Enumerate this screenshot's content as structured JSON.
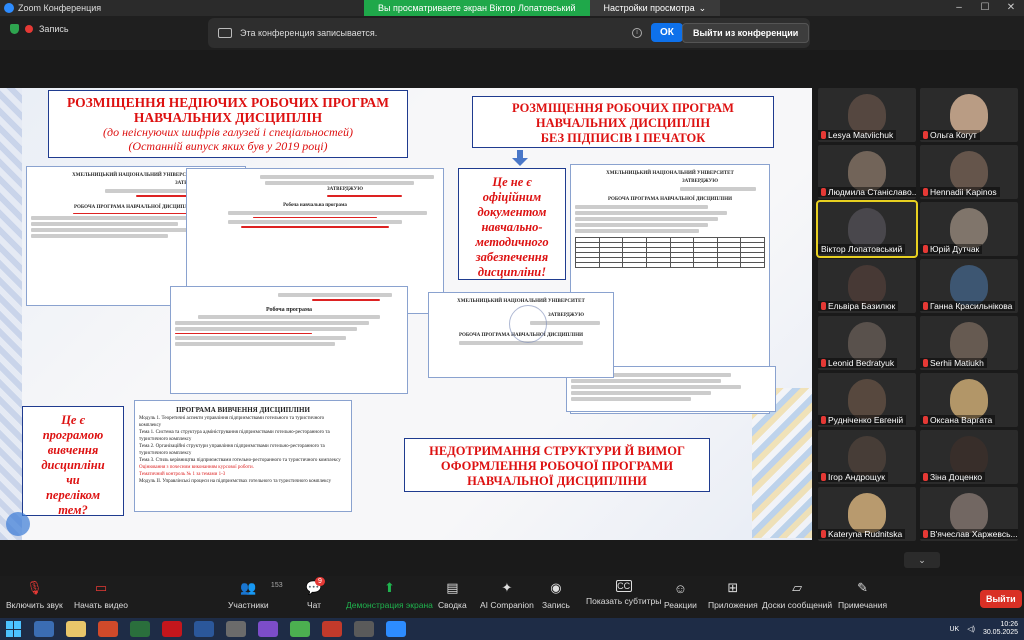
{
  "window": {
    "title": "Zoom Конференция"
  },
  "banner": {
    "viewing": "Вы просматриваете экран Віктор Лопатовський",
    "settings": "Настройки просмотра"
  },
  "recording": {
    "status": "Запись",
    "notice": "Эта конференция записывается.",
    "ok": "ОК",
    "leave": "Выйти из конференции"
  },
  "slide": {
    "box1_line1": "РОЗМІЩЕННЯ НЕДІЮЧИХ РОБОЧИХ ПРОГРАМ",
    "box1_line2": "НАВЧАЛЬНИХ ДИСЦИПЛІН",
    "box1_line3": "(до неіснуючих шифрів галузей і спеціальностей)",
    "box1_line4": "(Останній випуск яких був у 2019 році)",
    "box2_line1": "РОЗМІЩЕННЯ РОБОЧИХ ПРОГРАМ",
    "box2_line2": "НАВЧАЛЬНИХ ДИСЦИПЛІН",
    "box2_line3": "БЕЗ ПІДПИСІВ І ПЕЧАТОК",
    "box3": [
      "Це не є",
      "офіційним",
      "документом",
      "навчально-",
      "методичного",
      "забезпечення",
      "дисципліни!"
    ],
    "box4": [
      "Це є",
      "програмою",
      "вивчення",
      "дисципліни",
      "чи",
      "переліком",
      "тем?"
    ],
    "box5_line1": "НЕДОТРИМАННЯ СТРУКТУРИ Й ВИМОГ",
    "box5_line2": "ОФОРМЛЕННЯ РОБОЧОЇ ПРОГРАМИ",
    "box5_line3": "НАВЧАЛЬНОЇ ДИСЦИПЛІНИ",
    "doc_univ": "ХМЕЛЬНИЦЬКИЙ НАЦІОНАЛЬНИЙ УНІВЕРСИТЕТ",
    "doc_approve": "ЗАТВЕРДЖУЮ",
    "doc_rp": "РОБОЧА ПРОГРАМА НАВЧАЛЬНОЇ ДИСЦИПЛІНИ",
    "doc_rp2": "Робоча програма",
    "doc_plan": "Робоча навчальна програма",
    "doc_program": "ПРОГРАМА ВИВЧЕННЯ ДИСЦИПЛІНИ",
    "doc_program_items": [
      "Модуль 1. Теоретичні аспекти управління підприємствами готельного та туристичного комплексу",
      "Тема 1. Система та структура адміністрування підприємствами готельно-ресторанного та туристичного комплексу",
      "Тема 2. Організаційні структури управління підприємствами готельно-ресторанного та туристичного комплексу",
      "Тема 3. Стиль керівництва підприємствами готельно-ресторанного та туристичного комплексу",
      "Оцінювання з почесним виконанням курсової роботи.",
      "Тематичний контроль № 1 за темами 1-3",
      "Модуль II. Управлінські процеси на підприємствах готельного та туристичного комплексу"
    ]
  },
  "participants": [
    {
      "name": "Lesya Matviichuk",
      "muted": true,
      "color": "#5a4a42"
    },
    {
      "name": "Ольга Когут",
      "muted": true,
      "color": "#c9a98e"
    },
    {
      "name": "Людмила Станіславо...",
      "muted": true,
      "color": "#7a6a5e"
    },
    {
      "name": "Hennadii Kapinos",
      "muted": true,
      "color": "#6b5a4f"
    },
    {
      "name": "Віктор Лопатовський",
      "muted": false,
      "color": "#4d4a50"
    },
    {
      "name": "Юрій Дутчак",
      "muted": true,
      "color": "#8a7d72"
    },
    {
      "name": "Ельвіра Базилюк",
      "muted": true,
      "color": "#4a3b36"
    },
    {
      "name": "Ганна Красильнікова",
      "muted": true,
      "color": "#3f5b7a"
    },
    {
      "name": "Leonid Bedratyuk",
      "muted": true,
      "color": "#5e5550"
    },
    {
      "name": "Serhii Matiukh",
      "muted": true,
      "color": "#6d5f55"
    },
    {
      "name": "Рудніченко Евгеній",
      "muted": true,
      "color": "#5c4b40"
    },
    {
      "name": "Оксана Варгата",
      "muted": true,
      "color": "#c1a26f"
    },
    {
      "name": "Ігор Андрощук",
      "muted": true,
      "color": "#4a3f38"
    },
    {
      "name": "Зіна Доценко",
      "muted": true,
      "color": "#3a2f2a"
    },
    {
      "name": "Kateryna Rudnitska",
      "muted": true,
      "color": "#c8a676"
    },
    {
      "name": "В'ячеслав Харжевсь...",
      "muted": true,
      "color": "#7a6e68"
    }
  ],
  "toolbar": {
    "unmute": "Включить звук",
    "video": "Начать видео",
    "participants": "Участники",
    "participants_count": "153",
    "chat": "Чат",
    "chat_badge": "9",
    "share": "Демонстрация экрана",
    "summary": "Сводка",
    "ai": "AI Companion",
    "record": "Запись",
    "subtitles": "Показать субтитры",
    "reactions": "Реакции",
    "apps": "Приложения",
    "whiteboards": "Доски сообщений",
    "notes": "Примечания",
    "exit": "Выйти"
  },
  "taskbar": {
    "lang": "UK",
    "time": "10:26",
    "date": "30.05.2025"
  },
  "colors": {
    "accent": "#0e71eb",
    "record_green": "#1fa84a",
    "exit_red": "#d93025",
    "slide_red": "#d11111",
    "slide_border": "#1f3b8f"
  }
}
